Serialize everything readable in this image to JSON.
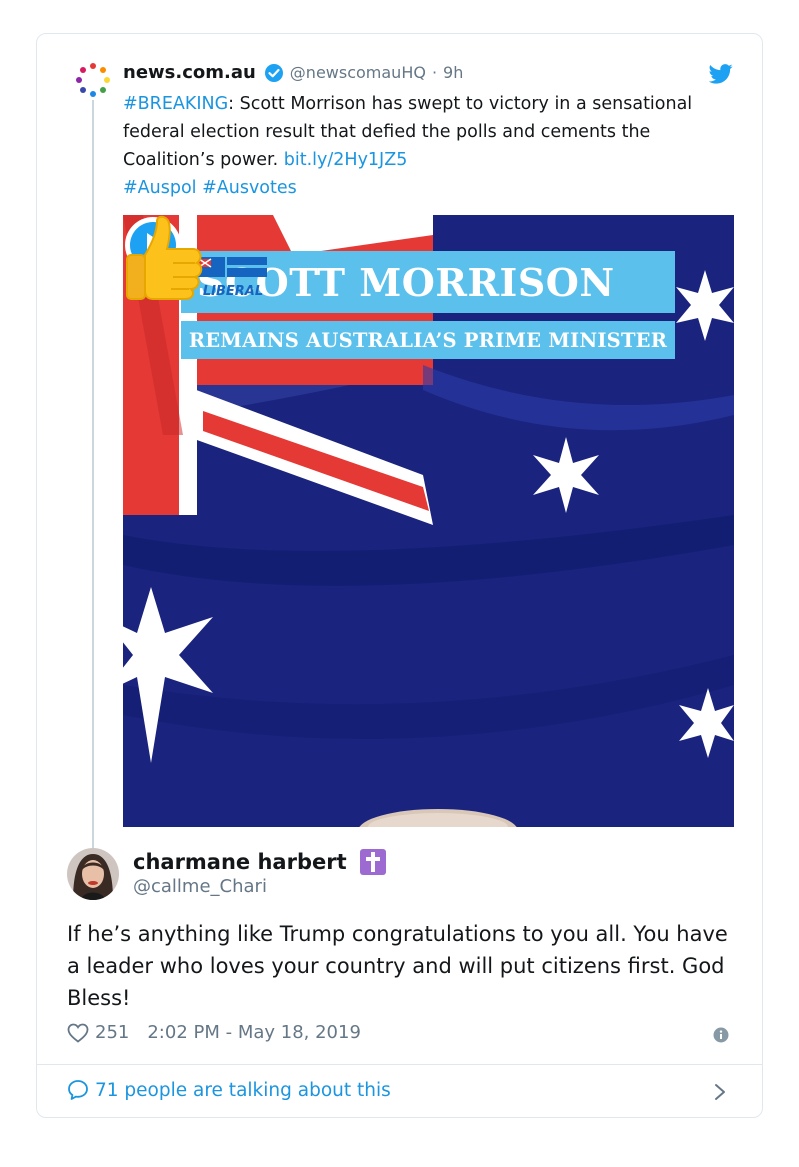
{
  "quoted_tweet": {
    "display_name": "news.com.au",
    "handle": "@newscomauHQ",
    "separator": "·",
    "time": "9h",
    "text": {
      "hashtag_breaking": "#BREAKING",
      "body": ": Scott Morrison has swept to victory in a sensational federal election result that defied the polls and cements the Coalition’s power.",
      "link": "bit.ly/2Hy1JZ5",
      "hashtag_auspol": "#Auspol",
      "hashtag_ausvotes": "#Ausvotes"
    },
    "media": {
      "logo_text": "LIBERAL",
      "banner_title": "SCOTT MORRISON",
      "banner_subtitle": "REMAINS AUSTRALIA’S PRIME MINISTER"
    }
  },
  "tweet": {
    "display_name": "charmane harbert",
    "handle": "@callme_Chari",
    "text": "If he’s anything like Trump congratulations to you all. You have a leader who loves your country and will put citizens first. God Bless!",
    "likes": "251",
    "timestamp": "2:02 PM - May 18, 2019"
  },
  "footer": {
    "talking_text": "71 people are talking about this"
  },
  "colors": {
    "link": "#1b95e0",
    "secondary_text": "#657786",
    "banner": "#5bc0eb",
    "flag_blue": "#1a237e"
  }
}
